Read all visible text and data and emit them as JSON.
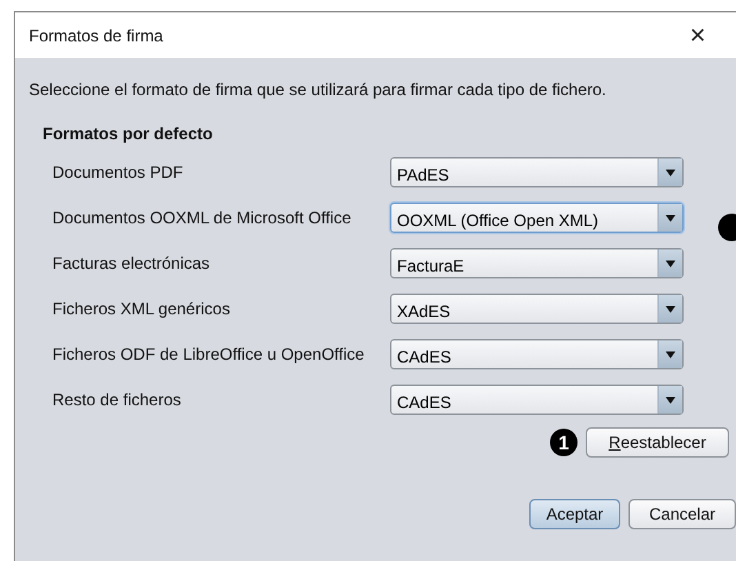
{
  "window": {
    "title": "Formatos de firma",
    "close": "×"
  },
  "instructions": "Seleccione el formato de firma que se utilizará para firmar cada tipo de fichero.",
  "section_title": "Formatos por defecto",
  "rows": [
    {
      "label": "Documentos PDF",
      "value": "PAdES",
      "focused": false
    },
    {
      "label": "Documentos OOXML de Microsoft Office",
      "value": "OOXML (Office Open XML)",
      "focused": true
    },
    {
      "label": "Facturas electrónicas",
      "value": "FacturaE",
      "focused": false
    },
    {
      "label": "Ficheros XML genéricos",
      "value": "XAdES",
      "focused": false
    },
    {
      "label": "Ficheros ODF de LibreOffice u OpenOffice",
      "value": "CAdES",
      "focused": false
    },
    {
      "label": "Resto de ficheros",
      "value": "CAdES",
      "focused": false
    }
  ],
  "reset": {
    "callout": "1",
    "label": "Reestablecer",
    "mnemonic_underlined": true
  },
  "buttons": [
    {
      "label": "Aceptar",
      "default": true
    },
    {
      "label": "Cancelar",
      "default": false
    }
  ]
}
